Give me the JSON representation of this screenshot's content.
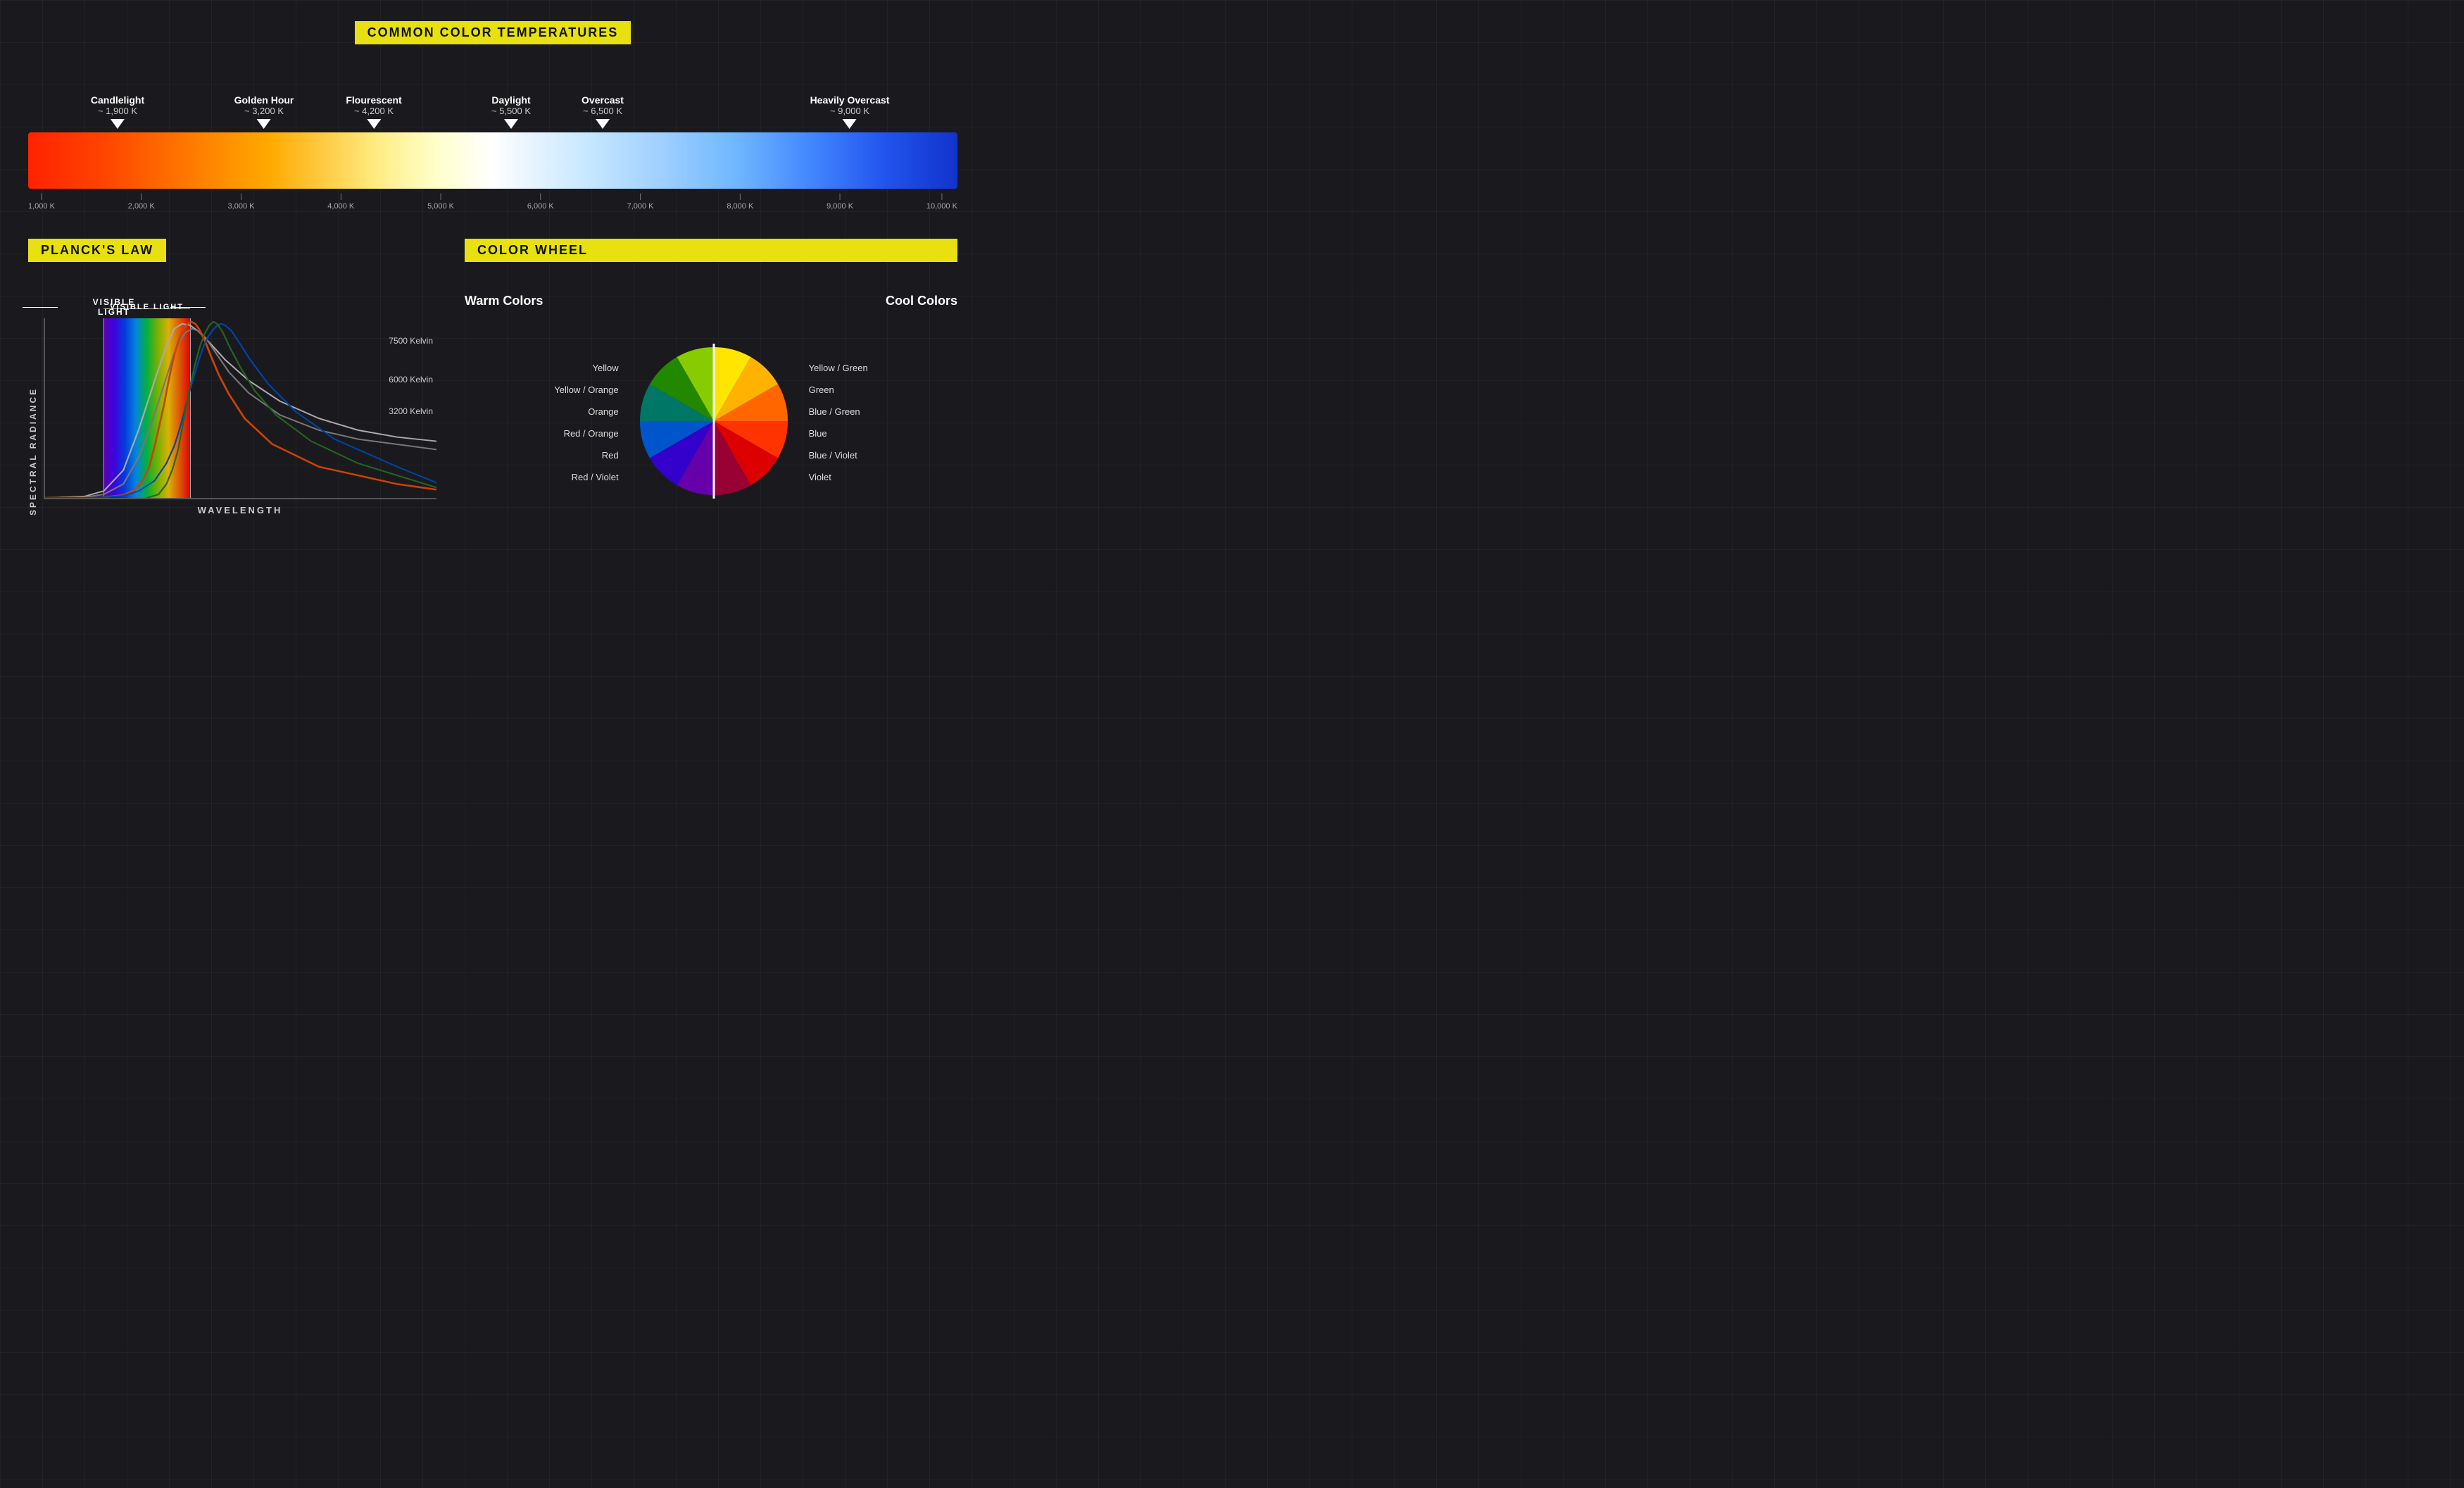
{
  "page": {
    "background": "#1a1a1e"
  },
  "top_section": {
    "title": "COMMON COLOR TEMPERATURES",
    "labels": [
      {
        "name": "Candlelight",
        "value": "~ 1,900 K",
        "position_pct": 9
      },
      {
        "name": "Golden Hour",
        "value": "~ 3,200 K",
        "position_pct": 25
      },
      {
        "name": "Flourescent",
        "value": "~ 4,200 K",
        "position_pct": 37
      },
      {
        "name": "Daylight",
        "value": "~ 5,500 K",
        "position_pct": 52
      },
      {
        "name": "Overcast",
        "value": "~ 6,500 K",
        "position_pct": 62
      },
      {
        "name": "Heavily Overcast",
        "value": "~ 9,000 K",
        "position_pct": 89
      }
    ],
    "ticks": [
      "1,000 K",
      "2,000 K",
      "3,000 K",
      "4,000 K",
      "5,000 K",
      "6,000 K",
      "7,000 K",
      "8,000 K",
      "9,000 K",
      "10,000 K"
    ]
  },
  "plancks_section": {
    "title": "PLANCK'S LAW",
    "visible_light_label": "VISIBLE LIGHT",
    "y_axis_label": "SPECTRAL RADIANCE",
    "x_axis_label": "WAVELENGTH",
    "curves": [
      {
        "label": "7500 Kelvin",
        "color": "#aaa"
      },
      {
        "label": "6000 Kelvin",
        "color": "#aaa"
      },
      {
        "label": "3200 Kelvin",
        "color": "#aaa"
      }
    ]
  },
  "color_wheel_section": {
    "title": "COLOR WHEEL",
    "warm_header": "Warm Colors",
    "cool_header": "Cool Colors",
    "warm_labels": [
      "Yellow",
      "Yellow / Orange",
      "Orange",
      "Red / Orange",
      "Red",
      "Red / Violet"
    ],
    "cool_labels": [
      "Yellow / Green",
      "Green",
      "Blue / Green",
      "Blue",
      "Blue / Violet",
      "Violet"
    ]
  }
}
